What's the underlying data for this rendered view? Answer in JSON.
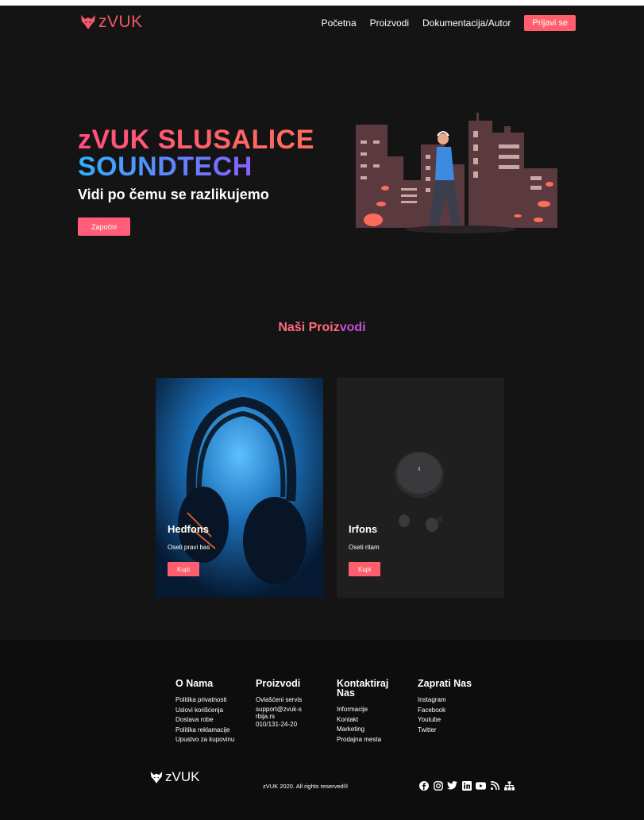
{
  "nav": {
    "logo_text": "zVUK",
    "links": [
      "Početna",
      "Proizvodi",
      "Dokumentacija/Autor"
    ],
    "login_label": "Prijavi se"
  },
  "hero": {
    "title_line1": "zVUK SLUSALICE",
    "title_line2": "SOUNDTECH",
    "subtitle": "Vidi po čemu se razlikujemo",
    "cta_label": "Započni"
  },
  "products": {
    "title_part1": "Naši Proiz",
    "title_part2": "vodi",
    "cards": [
      {
        "title": "Hedfons",
        "subtitle": "Oseti pravi bas",
        "button": "Kupi"
      },
      {
        "title": "Irfons",
        "subtitle": "Oseti ritam",
        "button": "Kupi"
      }
    ]
  },
  "footer": {
    "columns": [
      {
        "title": "O Nama",
        "items": [
          "Politika privatnosti",
          "Uslovi korišćenja",
          "Dostava robe",
          "Politika reklamacije",
          "Upustvo za kupovinu"
        ]
      },
      {
        "title": "Proizvodi",
        "items": [
          "Ovlašćeni servis",
          "support@zvuk-srbija.rs",
          "010/131-24-20"
        ]
      },
      {
        "title": "Kontaktiraj Nas",
        "items": [
          "Informacije",
          "Kontakt",
          "Marketing",
          "Prodajna mesta"
        ]
      },
      {
        "title": "Zaprati Nas",
        "items": [
          "Instagram",
          "Facebook",
          "Youtube",
          "Twitter"
        ]
      }
    ],
    "logo_text": "zVUK",
    "copyright": "zVUK 2020. All rights reserved®",
    "social_icons": [
      "facebook-icon",
      "instagram-icon",
      "twitter-icon",
      "linkedin-icon",
      "youtube-icon",
      "rss-icon",
      "sitemap-icon"
    ]
  },
  "colors": {
    "background": "#141414",
    "accent": "#ff5e6c",
    "footer_bg": "#0d0d0d"
  }
}
